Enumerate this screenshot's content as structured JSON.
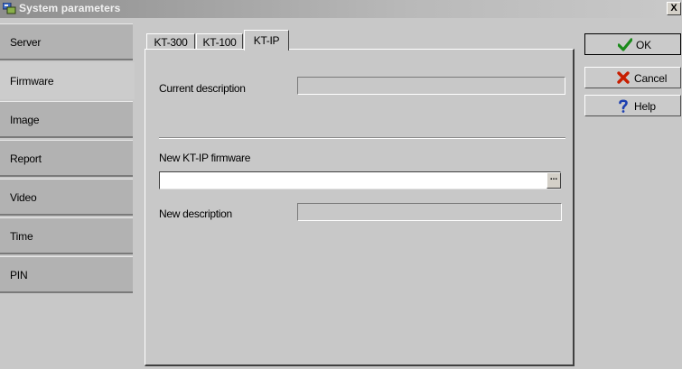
{
  "window": {
    "title": "System parameters",
    "close_glyph": "X"
  },
  "sidebar": {
    "items": [
      {
        "label": "Server"
      },
      {
        "label": "Firmware"
      },
      {
        "label": "Image"
      },
      {
        "label": "Report"
      },
      {
        "label": "Video"
      },
      {
        "label": "Time"
      },
      {
        "label": "PIN"
      }
    ],
    "active_index": 1
  },
  "tabs": [
    {
      "label": "KT-300"
    },
    {
      "label": "KT-100"
    },
    {
      "label": "KT-IP"
    }
  ],
  "active_tab_index": 2,
  "firmware": {
    "current_description_label": "Current description",
    "current_description_value": "",
    "new_firmware_label": "New KT-IP firmware",
    "new_firmware_value": "",
    "browse_label": "...",
    "new_description_label": "New description",
    "new_description_value": ""
  },
  "buttons": {
    "ok": {
      "label": "OK",
      "icon": "checkmark-icon",
      "color": "#1a8a1a"
    },
    "cancel": {
      "label": "Cancel",
      "icon": "x-mark-icon",
      "color": "#c81e00"
    },
    "help": {
      "label": "Help",
      "icon": "question-mark-icon",
      "color": "#1c3fb0"
    }
  }
}
